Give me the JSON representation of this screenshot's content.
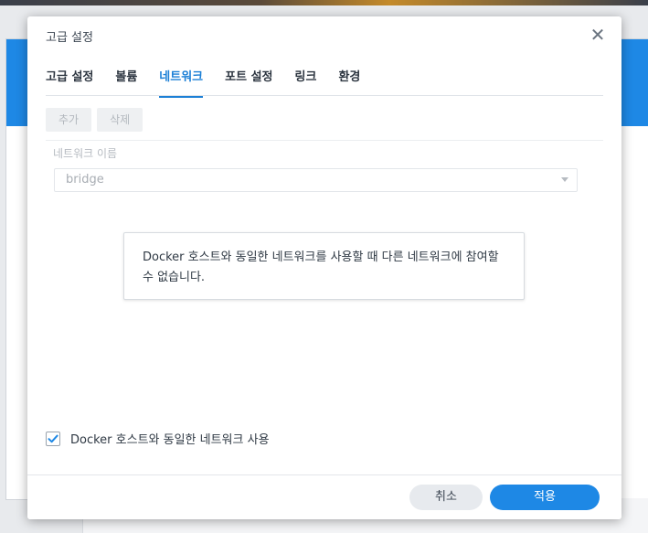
{
  "dialog": {
    "title": "고급 설정",
    "close_icon": "close-icon"
  },
  "tabs": [
    {
      "label": "고급 설정",
      "active": false
    },
    {
      "label": "볼륨",
      "active": false
    },
    {
      "label": "네트워크",
      "active": true
    },
    {
      "label": "포트 설정",
      "active": false
    },
    {
      "label": "링크",
      "active": false
    },
    {
      "label": "환경",
      "active": false
    }
  ],
  "toolbar": {
    "add_label": "추가",
    "delete_label": "삭제"
  },
  "network": {
    "column_header": "네트워크 이름",
    "selected_network": "bridge"
  },
  "info": {
    "message": "Docker 호스트와 동일한 네트워크를 사용할 때 다른 네트워크에 참여할 수 없습니다."
  },
  "use_host_network": {
    "label": "Docker 호스트와 동일한 네트워크 사용",
    "checked": true
  },
  "footer": {
    "cancel_label": "취소",
    "apply_label": "적용"
  },
  "colors": {
    "accent": "#1e88e5",
    "active_tab": "#1d80d6"
  }
}
